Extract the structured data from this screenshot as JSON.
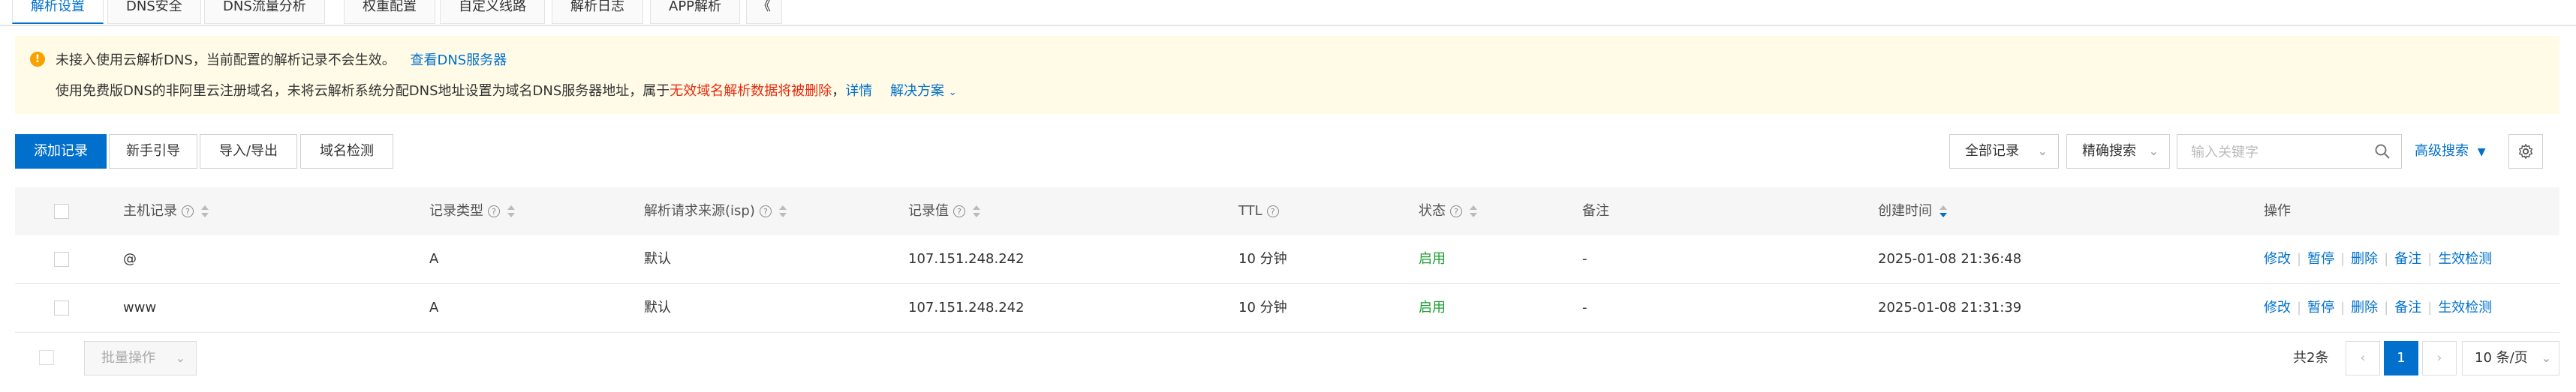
{
  "tabs": [
    "解析设置",
    "DNS安全",
    "DNS流量分析",
    "权重配置",
    "自定义线路",
    "解析日志",
    "APP解析",
    "《"
  ],
  "notice": {
    "line1_text": "未接入使用云解析DNS，当前配置的解析记录不会生效。",
    "line1_link": "查看DNS服务器",
    "line2_text": "使用免费版DNS的非阿里云注册域名，未将云解析系统分配DNS地址设置为域名DNS服务器地址，属于",
    "line2_red": "无效域名解析数据将被删除",
    "line2_sep": "，",
    "line2_link": "详情",
    "line2_link2": "解决方案",
    "line2_link2_icon": "chevron-down-icon"
  },
  "toolbar": {
    "add_record": "添加记录",
    "guide": "新手引导",
    "import_export": "导入/导出",
    "domain_check": "域名检测",
    "filter_all": "全部记录",
    "search_mode": "精确搜索",
    "search_placeholder": "输入关键字",
    "advanced_search": "高级搜索",
    "settings_icon": "gear-icon"
  },
  "table": {
    "headers": {
      "host": "主机记录",
      "type": "记录类型",
      "source": "解析请求来源(isp)",
      "value": "记录值",
      "ttl": "TTL",
      "status": "状态",
      "remark": "备注",
      "created": "创建时间",
      "ops": "操作"
    },
    "rows": [
      {
        "host": "@",
        "type": "A",
        "source": "默认",
        "value": "107.151.248.242",
        "ttl": "10 分钟",
        "status": "启用",
        "remark": "-",
        "created": "2025-01-08 21:36:48"
      },
      {
        "host": "www",
        "type": "A",
        "source": "默认",
        "value": "107.151.248.242",
        "ttl": "10 分钟",
        "status": "启用",
        "remark": "-",
        "created": "2025-01-08 21:31:39"
      }
    ],
    "actions": [
      "修改",
      "暂停",
      "删除",
      "备注",
      "生效检测"
    ]
  },
  "footer": {
    "batch": "批量操作",
    "total": "共2条",
    "current_page": "1",
    "page_size": "10 条/页"
  },
  "colors": {
    "accent": "#0070cc",
    "status_enabled": "#1e9e33",
    "warning_bg": "#fffbe6",
    "danger": "#e62a10"
  }
}
